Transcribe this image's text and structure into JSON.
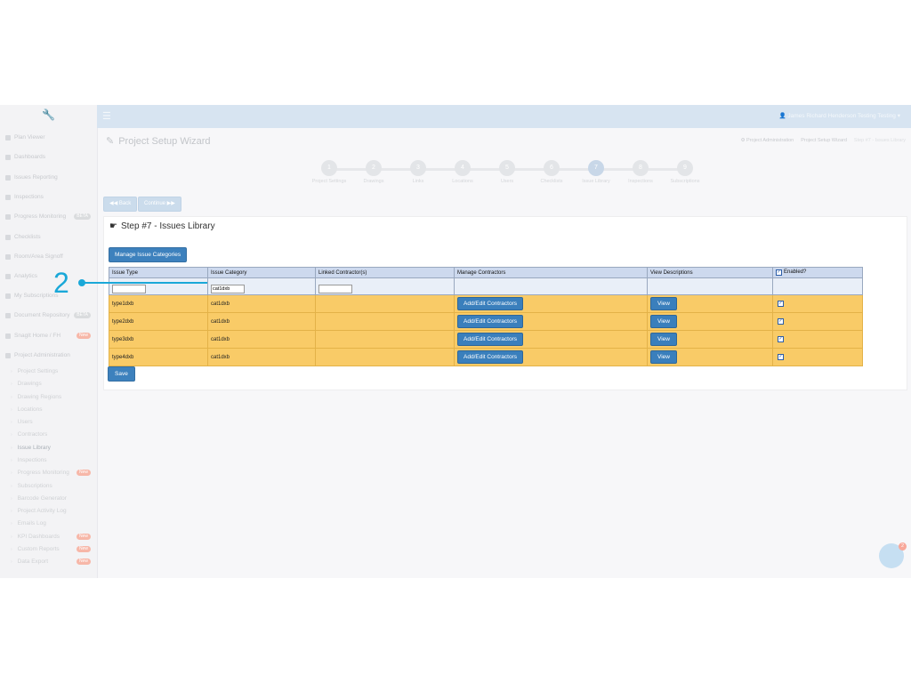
{
  "sidebar": {
    "items": [
      {
        "label": "Plan Viewer"
      },
      {
        "label": "Dashboards"
      },
      {
        "label": "Issues Reporting"
      },
      {
        "label": "Inspections"
      },
      {
        "label": "Progress Monitoring",
        "badge": "BETA"
      },
      {
        "label": "Checklists"
      },
      {
        "label": "Room/Area Signoff"
      },
      {
        "label": "Analytics"
      },
      {
        "label": "My Subscriptions"
      },
      {
        "label": "Document Repository",
        "badge": "BETA"
      },
      {
        "label": "SnagIt Home / FH",
        "badge": "New"
      },
      {
        "label": "Project Administration"
      }
    ],
    "subitems": [
      {
        "label": "Project Settings"
      },
      {
        "label": "Drawings"
      },
      {
        "label": "Drawing Regions"
      },
      {
        "label": "Locations"
      },
      {
        "label": "Users"
      },
      {
        "label": "Contractors"
      },
      {
        "label": "Issue Library"
      },
      {
        "label": "Inspections"
      },
      {
        "label": "Progress Monitoring",
        "badge": "New"
      },
      {
        "label": "Subscriptions"
      },
      {
        "label": "Barcode Generator"
      },
      {
        "label": "Project Activity Log"
      },
      {
        "label": "Emails Log"
      },
      {
        "label": "KPI Dashboards",
        "badge": "New"
      },
      {
        "label": "Custom Reports",
        "badge": "New"
      },
      {
        "label": "Data Export",
        "badge": "New"
      }
    ]
  },
  "topbar": {
    "user_name": "James Richard Henderson Testing Testing"
  },
  "page": {
    "title": "Project Setup Wizard",
    "breadcrumbs": [
      "Project Administration",
      "Project Setup Wizard",
      "Step #7 - Issues Library"
    ]
  },
  "wizard": {
    "steps": [
      {
        "num": "1",
        "label": "Project Settings"
      },
      {
        "num": "2",
        "label": "Drawings"
      },
      {
        "num": "3",
        "label": "Links"
      },
      {
        "num": "4",
        "label": "Locations"
      },
      {
        "num": "5",
        "label": "Users"
      },
      {
        "num": "6",
        "label": "Checklists"
      },
      {
        "num": "7",
        "label": "Issue Library"
      },
      {
        "num": "8",
        "label": "Inspections"
      },
      {
        "num": "9",
        "label": "Subscriptions"
      }
    ],
    "active_step": 7
  },
  "nav": {
    "back_label": "◀◀ Back",
    "continue_label": "Continue ▶▶"
  },
  "panel": {
    "title": "Step #7 - Issues Library",
    "manage_categories_label": "Manage Issue Categories",
    "save_label": "Save"
  },
  "table": {
    "headers": {
      "issue_type": "Issue Type",
      "issue_category": "Issue Category",
      "linked": "Linked Contractor(s)",
      "manage": "Manage Contractors",
      "view": "View Descriptions",
      "enabled": "Enabled?"
    },
    "filters": {
      "issue_type": "",
      "issue_category": "cat1dxb",
      "linked": ""
    },
    "add_edit_label": "Add/Edit Contractors",
    "view_label": "View",
    "rows": [
      {
        "type": "type1dxb",
        "category": "cat1dxb",
        "contractors": "",
        "enabled": true
      },
      {
        "type": "type2dxb",
        "category": "cat1dxb",
        "contractors": "",
        "enabled": true
      },
      {
        "type": "type3dxb",
        "category": "cat1dxb",
        "contractors": "",
        "enabled": true
      },
      {
        "type": "type4dxb",
        "category": "cat1dxb",
        "contractors": "",
        "enabled": true
      }
    ]
  },
  "annotation": {
    "number": "2",
    "color": "#1aa8d8"
  },
  "chat": {
    "badge": "2"
  }
}
